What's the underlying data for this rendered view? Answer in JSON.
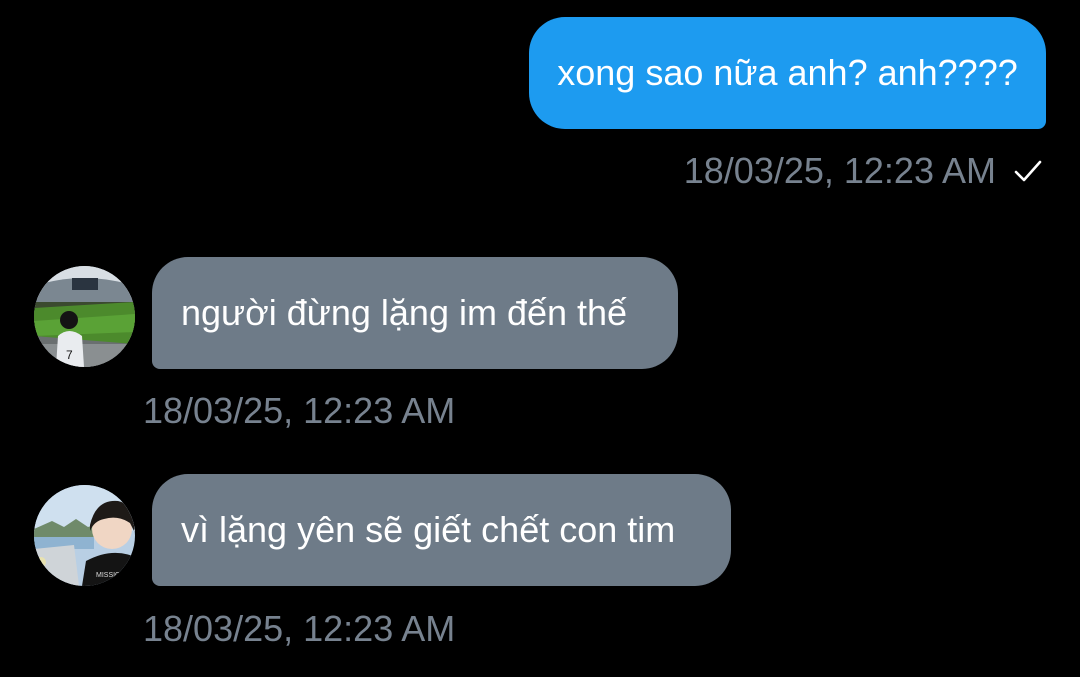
{
  "colors": {
    "background": "#000000",
    "outgoing_bubble": "#1d9bf0",
    "incoming_bubble": "#6e7b88",
    "timestamp": "#77828f",
    "text": "#ffffff"
  },
  "messages": [
    {
      "direction": "outgoing",
      "text": "xong sao nữa anh? anh????",
      "timestamp": "18/03/25, 12:23 AM",
      "status_icon": "check-icon"
    },
    {
      "direction": "incoming",
      "text": "người đừng lặng im đến thế",
      "timestamp": "18/03/25, 12:23 AM",
      "avatar_icon": "stadium-avatar"
    },
    {
      "direction": "incoming",
      "text": "vì lặng yên sẽ giết chết con tim",
      "timestamp": "18/03/25, 12:23 AM",
      "avatar_icon": "harbor-avatar"
    }
  ]
}
